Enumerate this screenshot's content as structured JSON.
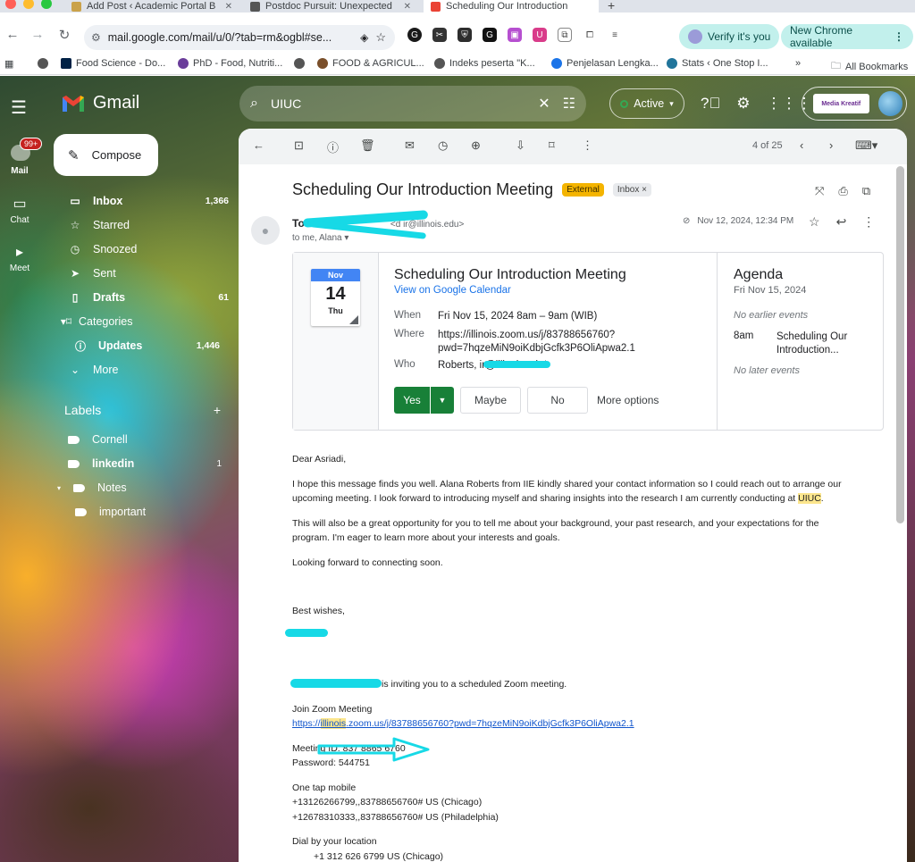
{
  "browser": {
    "tabs": [
      {
        "title": "Add Post ‹ Academic Portal B"
      },
      {
        "title": "Postdoc Pursuit: Unexpected"
      },
      {
        "title": "Scheduling Our Introduction"
      }
    ],
    "url": "mail.google.com/mail/u/0/?tab=rm&ogbl#se...",
    "verify_label": "Verify it's you",
    "new_chrome_label": "New Chrome available",
    "bookmarks": [
      "Food Science - Do...",
      "PhD - Food, Nutriti...",
      "FOOD & AGRICUL...",
      "Indeks peserta \"K...",
      "Penjelasan Lengka...",
      "Stats ‹ One Stop I..."
    ],
    "all_bookmarks": "All Bookmarks",
    "more_bookmarks": "»"
  },
  "gmail": {
    "logo_text": "Gmail",
    "search_value": "UIUC",
    "status": "Active",
    "account_brand": "Media Kreatif",
    "rail": {
      "mail_badge": "99+",
      "mail": "Mail",
      "chat": "Chat",
      "meet": "Meet"
    },
    "compose": "Compose",
    "nav": [
      {
        "label": "Inbox",
        "count": "1,366"
      },
      {
        "label": "Starred",
        "count": ""
      },
      {
        "label": "Snoozed",
        "count": ""
      },
      {
        "label": "Sent",
        "count": ""
      },
      {
        "label": "Drafts",
        "count": "61"
      },
      {
        "label": "Categories",
        "count": ""
      },
      {
        "label": "Updates",
        "count": "1,446"
      },
      {
        "label": "More",
        "count": ""
      }
    ],
    "labels_heading": "Labels",
    "labels": [
      {
        "label": "Cornell",
        "count": ""
      },
      {
        "label": "linkedin",
        "count": "1"
      },
      {
        "label": "Notes",
        "count": ""
      },
      {
        "label": "important",
        "count": ""
      }
    ]
  },
  "message": {
    "pager": "4 of 25",
    "subject": "Scheduling Our Introduction Meeting",
    "tag_external": "External",
    "tag_inbox": "Inbox ×",
    "sender_name": "To",
    "sender_email": "<d     ir@illinois.edu>",
    "to_line": "to me, Alana",
    "date": "Nov 12, 2024, 12:34 PM",
    "calendar": {
      "month": "Nov",
      "day": "14",
      "weekday": "Thu",
      "title": "Scheduling Our Introduction Meeting",
      "view_link": "View on Google Calendar",
      "when_label": "When",
      "when": "Fri Nov 15, 2024 8am – 9am (WIB)",
      "where_label": "Where",
      "where_line1": "https://illinois.zoom.us/j/83788656760?",
      "where_line2": "pwd=7hqzeMiN9oiKdbjGcfk3P6OliApwa2.1",
      "who_label": "Who",
      "who": "Roberts,            ir@illinois.edu*",
      "yes": "Yes",
      "maybe": "Maybe",
      "no": "No",
      "more_options": "More options",
      "agenda_title": "Agenda",
      "agenda_date": "Fri Nov 15, 2024",
      "no_earlier": "No earlier events",
      "agenda_time": "8am",
      "agenda_event_1": "Scheduling Our",
      "agenda_event_2": "Introduction...",
      "no_later": "No later events"
    },
    "body": {
      "greeting": "Dear Asriadi,",
      "p1_a": "I hope this message finds you well. Alana Roberts from IIE kindly shared your contact information so I could reach out to arrange our upcoming meeting. I look forward to introducing myself and sharing insights into the research I am currently conducting at ",
      "p1_hl": "UIUC",
      "p1_b": ".",
      "p2": "This will also be a great opportunity for you to tell me about your background, your past research, and your expectations for the program. I'm eager to learn more about your interests and goals.",
      "p3": "Looking forward to connecting soon.",
      "signoff": "Best wishes,",
      "invite": " is inviting you to a scheduled Zoom meeting.",
      "join_heading": "Join Zoom Meeting",
      "join_pre": "https://",
      "join_hl": "illinois",
      "join_post": ".zoom.us/j/83788656760?pwd=7hqzeMiN9oiKdbjGcfk3P6OliApwa2.1",
      "meeting_id": "Meeting ID: 837 8865 6760",
      "password": "Password: 544751",
      "one_tap": "One tap mobile",
      "tap1": "+13126266799,,83788656760# US (Chicago)",
      "tap2": "+12678310333,,83788656760# US (Philadelphia)",
      "dial_heading": "Dial by your location",
      "dial1": "+1 312 626 6799 US (Chicago)"
    }
  }
}
